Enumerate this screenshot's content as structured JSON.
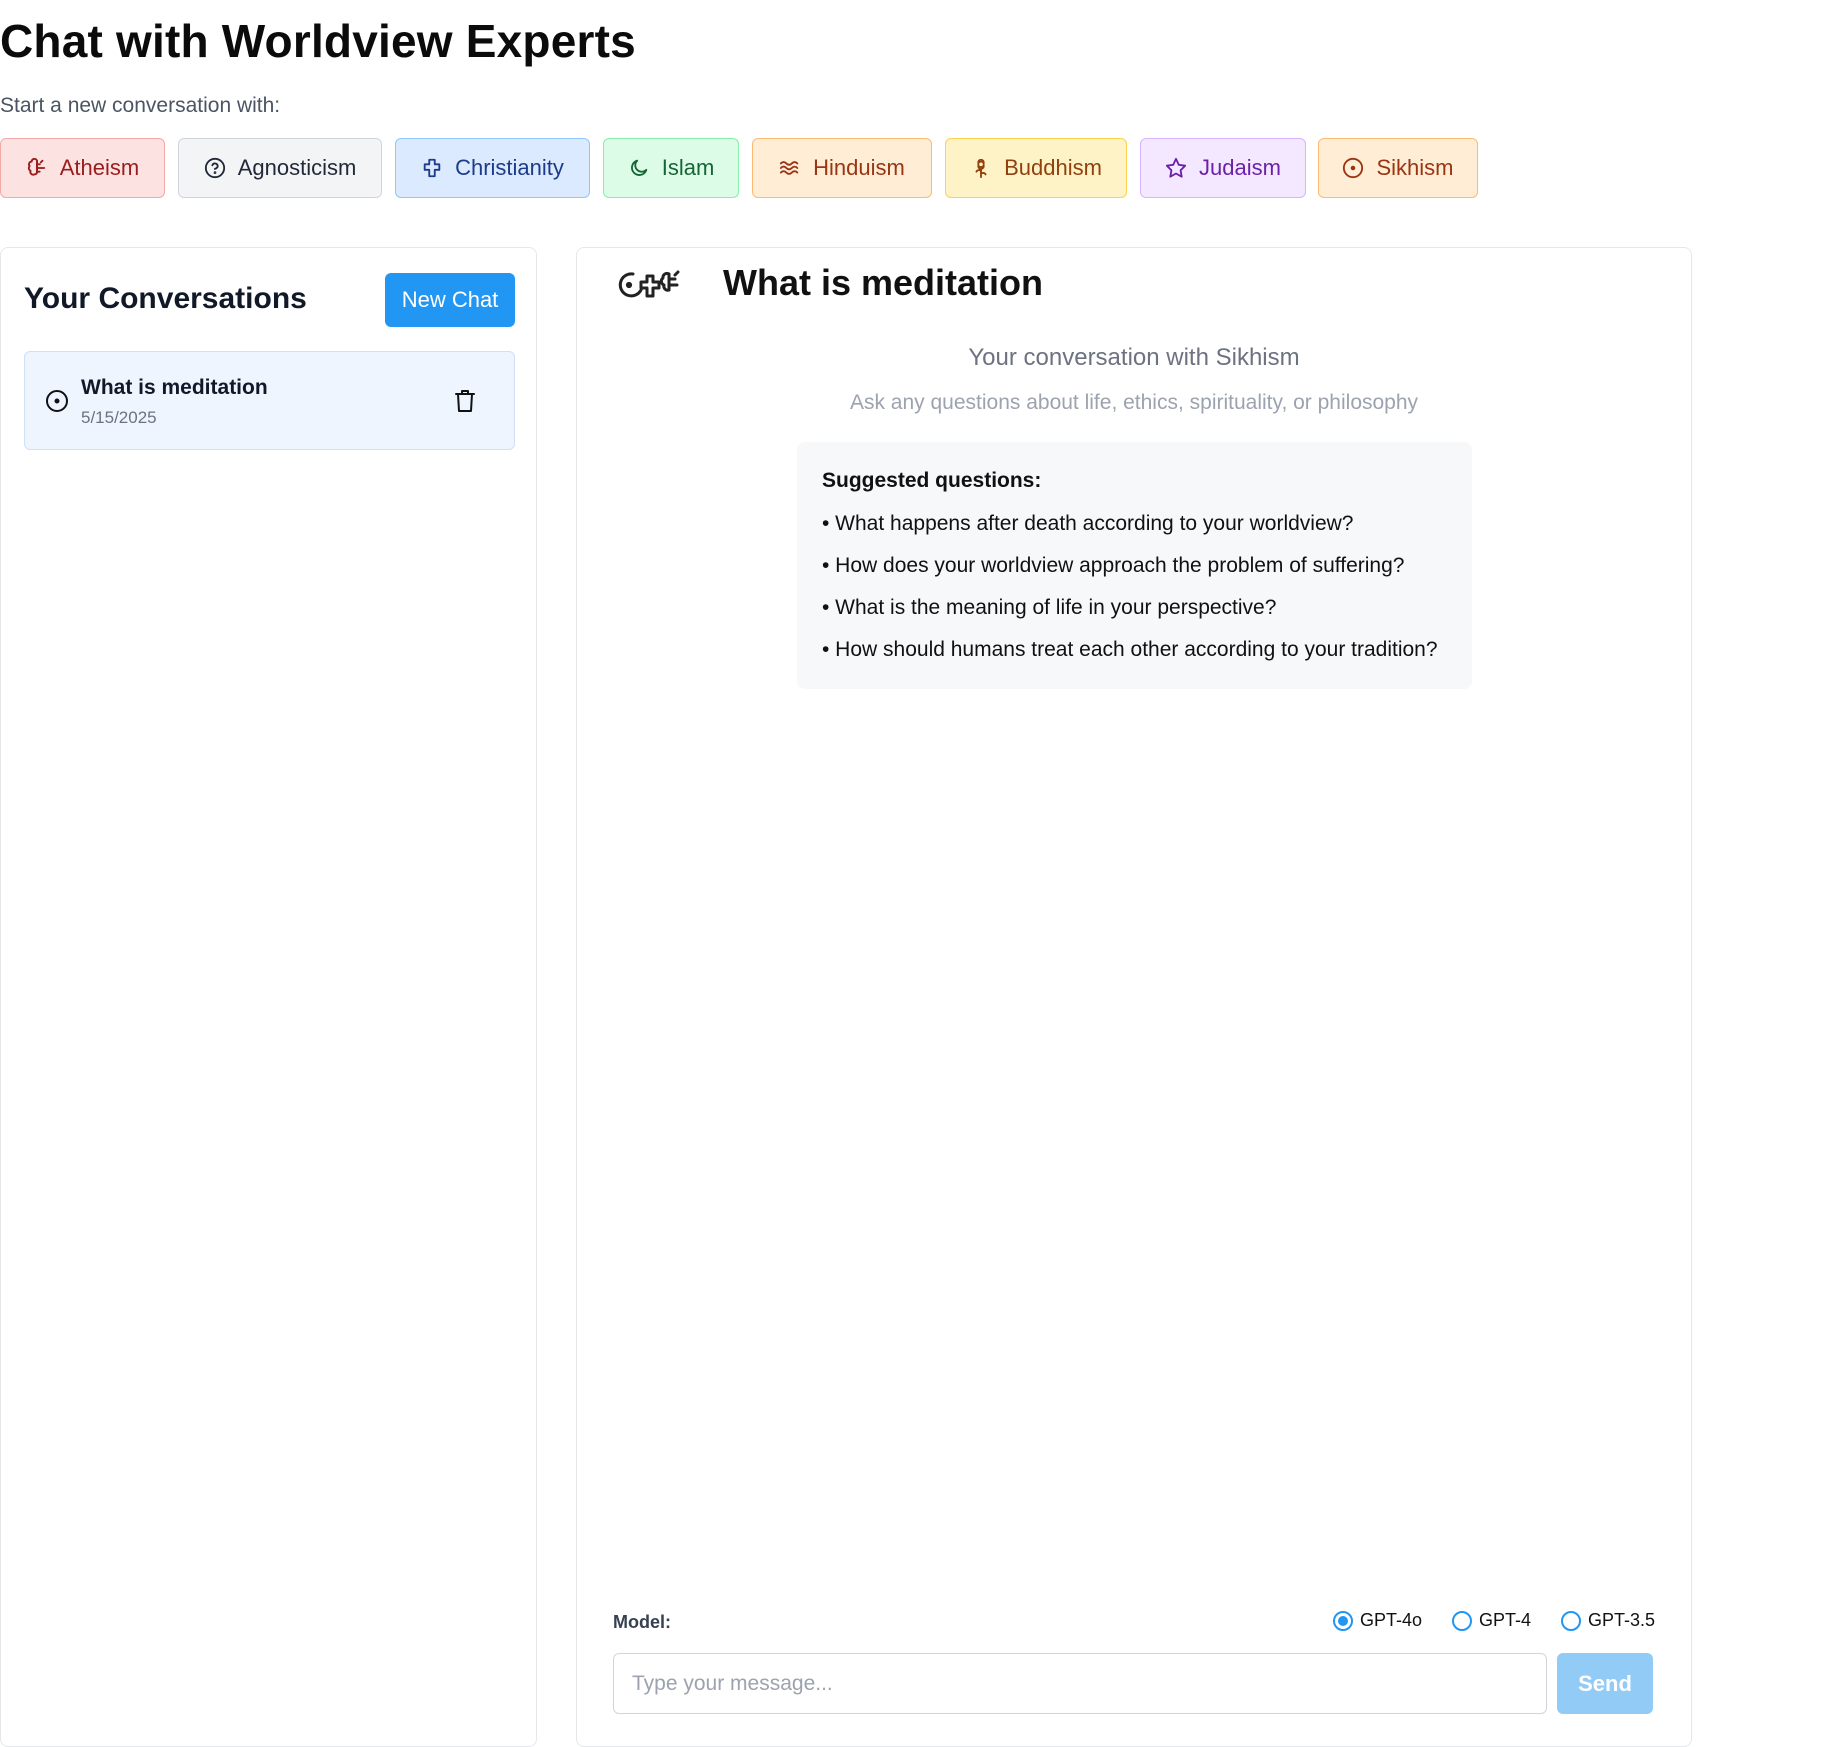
{
  "header": {
    "title": "Chat with Worldview Experts",
    "subtitle": "Start a new conversation with:"
  },
  "worldviews": [
    {
      "label": "Atheism",
      "icon": "brain-icon",
      "bg": "#fde2e2",
      "border": "#f4a9a9",
      "text": "#9b1c1c"
    },
    {
      "label": "Agnosticism",
      "icon": "question-circle-icon",
      "bg": "#f3f4f6",
      "border": "#d1d5db",
      "text": "#1f2937"
    },
    {
      "label": "Christianity",
      "icon": "cross-icon",
      "bg": "#dbeafe",
      "border": "#93c5fd",
      "text": "#1e3a8a"
    },
    {
      "label": "Islam",
      "icon": "crescent-moon-icon",
      "bg": "#dcfce7",
      "border": "#86efac",
      "text": "#166534"
    },
    {
      "label": "Hinduism",
      "icon": "waves-icon",
      "bg": "#ffedd5",
      "border": "#fdba74",
      "text": "#9a3412"
    },
    {
      "label": "Buddhism",
      "icon": "flower-icon",
      "bg": "#fef3c7",
      "border": "#fcd34d",
      "text": "#92400e"
    },
    {
      "label": "Judaism",
      "icon": "star-icon",
      "bg": "#f3e8ff",
      "border": "#d8b4fe",
      "text": "#6b21a8"
    },
    {
      "label": "Sikhism",
      "icon": "circle-dot-icon",
      "bg": "#ffedd5",
      "border": "#fdba74",
      "text": "#9a3412"
    }
  ],
  "sidebar": {
    "title": "Your Conversations",
    "new_chat_label": "New Chat",
    "conversations": [
      {
        "title": "What is meditation",
        "date": "5/15/2025",
        "icon": "circle-dot-icon"
      }
    ]
  },
  "chat": {
    "title": "What is meditation",
    "header_icon": "worldview-icons-cluster",
    "conversation_with": "Your conversation with Sikhism",
    "ask_prompt": "Ask any questions about life, ethics, spirituality, or philosophy",
    "suggested_heading": "Suggested questions:",
    "suggested_questions": [
      "• What happens after death according to your worldview?",
      "• How does your worldview approach the problem of suffering?",
      "• What is the meaning of life in your perspective?",
      "• How should humans treat each other according to your tradition?"
    ]
  },
  "model": {
    "label": "Model:",
    "options": [
      "GPT-4o",
      "GPT-4",
      "GPT-3.5"
    ],
    "selected": "GPT-4o"
  },
  "composer": {
    "placeholder": "Type your message...",
    "send_label": "Send"
  },
  "colors": {
    "accent": "#2196f3",
    "send_disabled": "#93cbf7",
    "active_conversation_bg": "#eff5ff"
  }
}
